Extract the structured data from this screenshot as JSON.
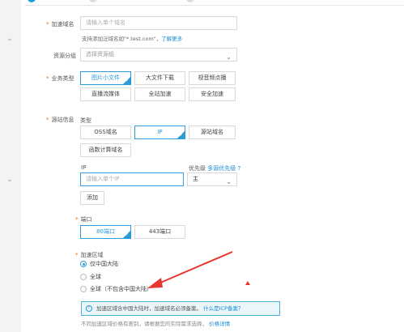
{
  "form": {
    "domain": {
      "label": "加速域名",
      "placeholder": "请输入单个域名",
      "hint": "支持添加泛域名如\"*.test.com\"，",
      "hint_link": "了解更多"
    },
    "resource_group": {
      "label": "资源分组",
      "value": "选择资源组"
    },
    "business_type": {
      "label": "业务类型",
      "options": [
        "图片小文件",
        "大文件下载",
        "视音频点播",
        "直播流媒体",
        "全站加速",
        "安全加速"
      ],
      "selected": "图片小文件"
    },
    "origin": {
      "label": "源站信息",
      "type_label": "类型",
      "types": [
        "OSS域名",
        "IP",
        "源站域名",
        "函数计算域名"
      ],
      "selected_type": "IP",
      "ip_label": "IP",
      "ip_placeholder": "请输入单个IP",
      "priority_label": "优先级",
      "priority_link": "多源优先级 ?",
      "priority_value": "主",
      "add_label": "添加"
    },
    "port": {
      "label": "端口",
      "options": [
        "80端口",
        "443端口"
      ],
      "selected": "80端口"
    },
    "region": {
      "label": "加速区域",
      "options": [
        "仅中国大陆",
        "全球",
        "全球（不包含中国大陆）"
      ],
      "selected": "仅中国大陆"
    },
    "notice": {
      "text": "加速区域含中国大陆时，加速域名必须备案。",
      "link": "什么是ICP备案？"
    },
    "footnote": {
      "text": "不同加速区域价格有差别，请根据您的实际需求选择，",
      "link": "价格详情"
    }
  },
  "colors": {
    "accent": "#2a9ad8",
    "required": "#f56a00",
    "annotation": "#e8352f"
  }
}
